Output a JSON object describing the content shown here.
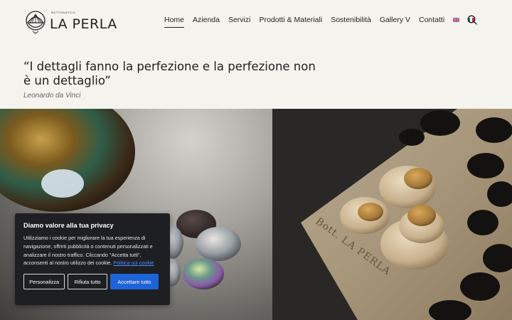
{
  "logo": {
    "small_text": "BOTTONIFICIO",
    "name": "LA PERLA"
  },
  "nav": {
    "items": [
      {
        "label": "Home",
        "active": true
      },
      {
        "label": "Azienda"
      },
      {
        "label": "Servizi"
      },
      {
        "label": "Prodotti & Materiali"
      },
      {
        "label": "Sostenibilità"
      },
      {
        "label": "Gallery V"
      },
      {
        "label": "Contatti"
      }
    ],
    "languages": [
      "en-flag-icon",
      "it-flag-icon"
    ],
    "search_icon": "search-icon"
  },
  "quote": {
    "text": "“I dettagli fanno la perfezione e la perfezione non è un dettaglio”",
    "author": "Leonardo da Vinci"
  },
  "hero": {
    "board_engraving": "Bott. LA PERLA"
  },
  "cookie_banner": {
    "title": "Diamo valore alla tua privacy",
    "body": "Utilizziamo i cookie per migliorare la tua esperienza di navigazione, offrirti pubblicità o contenuti personalizzati e analizzare il nostro traffico. Cliccando \"Accetta tutti\", acconsenti al nostro utilizzo dei cookie.",
    "policy_link": "Politica sui cookie",
    "buttons": {
      "customize": "Personalizza",
      "reject": "Rifiuta tutto",
      "accept": "Accettare tutto"
    },
    "accent_color": "#1f63d8"
  }
}
